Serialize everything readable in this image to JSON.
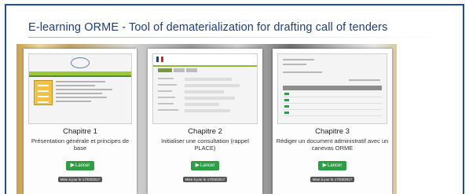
{
  "page": {
    "title": "E-learning ORME - Tool of dematerialization for  drafting call of tenders"
  },
  "cards": [
    {
      "chapter": "Chapitre 1",
      "description": "Présentation générale et principes de base",
      "button_label": "Lancer",
      "button_icon": "play-icon",
      "update_label": "Mise à jour le 17/03/2017"
    },
    {
      "chapter": "Chapitre 2",
      "description": "Initialiser une consultation (rappel PLACE)",
      "button_label": "Lancer",
      "button_icon": "play-icon",
      "update_label": "Mise à jour le 17/03/2017"
    },
    {
      "chapter": "Chapitre 3",
      "description": "Rédiger un document administratif avec un canevas ORME",
      "button_label": "Lancer",
      "button_icon": "play-icon",
      "update_label": "Mise à jour le 17/03/2017"
    }
  ],
  "colors": {
    "title": "#1f3f7a",
    "border": "#1f4e8c",
    "button": "#2e9e45",
    "badge": "#555555"
  }
}
